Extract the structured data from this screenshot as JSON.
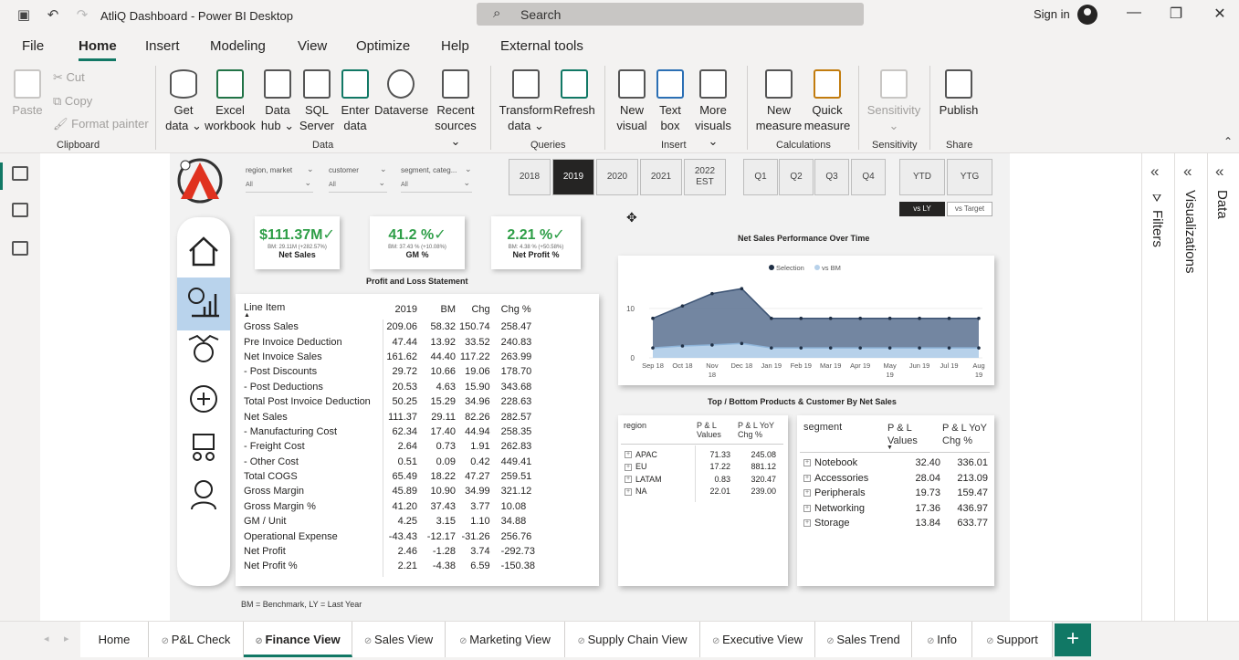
{
  "window": {
    "title": "AtliQ Dashboard - Power BI Desktop",
    "search_placeholder": "Search",
    "signin": "Sign in"
  },
  "menu": [
    "File",
    "Home",
    "Insert",
    "Modeling",
    "View",
    "Optimize",
    "Help",
    "External tools"
  ],
  "ribbon": {
    "clipboard": {
      "paste": "Paste",
      "cut": "Cut",
      "copy": "Copy",
      "format_painter": "Format painter",
      "label": "Clipboard"
    },
    "data": {
      "get_data": [
        "Get",
        "data ⌄"
      ],
      "excel": [
        "Excel",
        "workbook"
      ],
      "data_hub": [
        "Data",
        "hub ⌄"
      ],
      "sql": [
        "SQL",
        "Server"
      ],
      "enter": [
        "Enter",
        "data"
      ],
      "dataverse": [
        "Dataverse",
        ""
      ],
      "recent": [
        "Recent",
        "sources ⌄"
      ],
      "label": "Data"
    },
    "queries": {
      "transform": [
        "Transform",
        "data ⌄"
      ],
      "refresh": [
        "Refresh",
        ""
      ],
      "label": "Queries"
    },
    "insert": {
      "new_visual": [
        "New",
        "visual"
      ],
      "text_box": [
        "Text",
        "box"
      ],
      "more_visuals": [
        "More",
        "visuals ⌄"
      ],
      "label": "Insert"
    },
    "calculations": {
      "new_measure": [
        "New",
        "measure"
      ],
      "quick_measure": [
        "Quick",
        "measure"
      ],
      "label": "Calculations"
    },
    "sensitivity": {
      "btn": [
        "Sensitivity",
        "⌄"
      ],
      "label": "Sensitivity"
    },
    "share": {
      "publish": [
        "Publish",
        ""
      ],
      "label": "Share"
    }
  },
  "panes": {
    "filters": "Filters",
    "visualizations": "Visualizations",
    "data": "Data"
  },
  "page_tabs": [
    "Home",
    "P&L Check",
    "Finance View",
    "Sales View",
    "Marketing View",
    "Supply Chain View",
    "Executive View",
    "Sales Trend",
    "Info",
    "Support"
  ],
  "add_page": "+",
  "report": {
    "slicers": [
      {
        "label": "region, market",
        "value": "All"
      },
      {
        "label": "customer",
        "value": "All"
      },
      {
        "label": "segment, categ...",
        "value": "All"
      }
    ],
    "years": [
      "2018",
      "2019",
      "2020",
      "2021",
      "2022 EST"
    ],
    "quarters": [
      "Q1",
      "Q2",
      "Q3",
      "Q4"
    ],
    "ytd": "YTD",
    "ytg": "YTG",
    "vs_ly": "vs LY",
    "vs_target": "vs Target",
    "kpis": [
      {
        "value": "$111.37M✓",
        "sub": "BM: 29.11M (+282.57%)",
        "label": "Net Sales"
      },
      {
        "value": "41.2 %✓",
        "sub": "BM: 37.43 % (+10.08%)",
        "label": "GM %"
      },
      {
        "value": "2.21 %✓",
        "sub": "BM: 4.38 % (+50.58%)",
        "label": "Net Profit %"
      }
    ],
    "pl_title": "Profit and Loss Statement",
    "pl_headers": [
      "Line Item",
      "2019",
      "BM",
      "Chg",
      "Chg %"
    ],
    "pl_rows": [
      [
        "Gross Sales",
        "209.06",
        "58.32",
        "150.74",
        "258.47"
      ],
      [
        "Pre Invoice Deduction",
        "47.44",
        "13.92",
        "33.52",
        "240.83"
      ],
      [
        "Net Invoice Sales",
        "161.62",
        "44.40",
        "117.22",
        "263.99"
      ],
      [
        "- Post Discounts",
        "29.72",
        "10.66",
        "19.06",
        "178.70"
      ],
      [
        "- Post Deductions",
        "20.53",
        "4.63",
        "15.90",
        "343.68"
      ],
      [
        "Total Post Invoice Deduction",
        "50.25",
        "15.29",
        "34.96",
        "228.63"
      ],
      [
        "Net Sales",
        "111.37",
        "29.11",
        "82.26",
        "282.57"
      ],
      [
        "- Manufacturing Cost",
        "62.34",
        "17.40",
        "44.94",
        "258.35"
      ],
      [
        "- Freight Cost",
        "2.64",
        "0.73",
        "1.91",
        "262.83"
      ],
      [
        "- Other Cost",
        "0.51",
        "0.09",
        "0.42",
        "449.41"
      ],
      [
        "Total COGS",
        "65.49",
        "18.22",
        "47.27",
        "259.51"
      ],
      [
        "Gross Margin",
        "45.89",
        "10.90",
        "34.99",
        "321.12"
      ],
      [
        "Gross Margin %",
        "41.20",
        "37.43",
        "3.77",
        "10.08"
      ],
      [
        "GM / Unit",
        "4.25",
        "3.15",
        "1.10",
        "34.88"
      ],
      [
        "Operational Expense",
        "-43.43",
        "-12.17",
        "-31.26",
        "256.76"
      ],
      [
        "Net Profit",
        "2.46",
        "-1.28",
        "3.74",
        "-292.73"
      ],
      [
        "Net Profit %",
        "2.21",
        "-4.38",
        "6.59",
        "-150.38"
      ]
    ],
    "top_bottom_title": "Top / Bottom Products & Customer By Net Sales",
    "region_headers": [
      "region",
      "P & L Values",
      "P & L YoY Chg %"
    ],
    "region_rows": [
      [
        "APAC",
        "71.33",
        "245.08"
      ],
      [
        "EU",
        "17.22",
        "881.12"
      ],
      [
        "LATAM",
        "0.83",
        "320.47"
      ],
      [
        "NA",
        "22.01",
        "239.00"
      ]
    ],
    "segment_headers": [
      "segment",
      "P & L Values",
      "P & L YoY Chg %"
    ],
    "segment_rows": [
      [
        "Notebook",
        "32.40",
        "336.01"
      ],
      [
        "Accessories",
        "28.04",
        "213.09"
      ],
      [
        "Peripherals",
        "19.73",
        "159.47"
      ],
      [
        "Networking",
        "17.36",
        "436.97"
      ],
      [
        "Storage",
        "13.84",
        "633.77"
      ]
    ],
    "footnote": "BM = Benchmark, LY = Last Year"
  },
  "chart_data": {
    "type": "area",
    "title": "Net Sales Performance Over Time",
    "categories": [
      "Sep 18",
      "Oct 18",
      "Nov 18",
      "Dec 18",
      "Jan 19",
      "Feb 19",
      "Mar 19",
      "Apr 19",
      "May 19",
      "Jun 19",
      "Jul 19",
      "Aug 19"
    ],
    "category_lines": [
      [
        "Sep 18"
      ],
      [
        "Oct 18"
      ],
      [
        "Nov",
        "18"
      ],
      [
        "Dec 18"
      ],
      [
        "Jan 19"
      ],
      [
        "Feb 19"
      ],
      [
        "Mar 19"
      ],
      [
        "Apr 19"
      ],
      [
        "May",
        "19"
      ],
      [
        "Jun 19"
      ],
      [
        "Jul 19"
      ],
      [
        "Aug",
        "19"
      ]
    ],
    "series": [
      {
        "name": "Selection",
        "values": [
          8,
          10.5,
          13,
          14,
          8,
          8,
          8,
          8,
          8,
          8,
          8,
          8
        ],
        "color": "#5b7190"
      },
      {
        "name": "vs BM",
        "values": [
          2,
          2.4,
          2.6,
          2.9,
          2,
          2,
          2,
          2,
          2,
          2,
          2,
          2
        ],
        "color": "#b7d1ea"
      }
    ],
    "yticks": [
      "10",
      "0"
    ],
    "ylim": [
      0,
      17
    ],
    "legend": "top-center"
  }
}
